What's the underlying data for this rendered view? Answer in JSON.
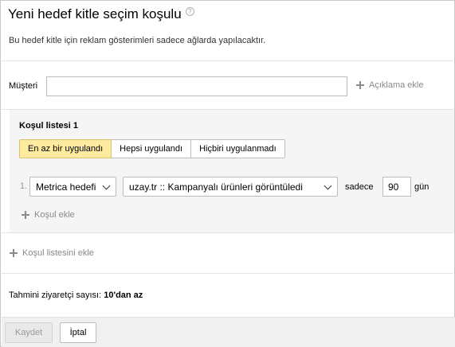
{
  "dialog": {
    "title": "Yeni hedef kitle seçim koşulu",
    "help_icon": "question-circle-icon",
    "subtitle": "Bu hedef kitle için reklam gösterimleri sadece ağlarda yapılacaktır."
  },
  "customer": {
    "label": "Müşteri",
    "value": "",
    "placeholder": "",
    "description_link": "Açıklama ekle"
  },
  "condition_list": {
    "title": "Koşul listesi 1",
    "modes": [
      {
        "label": "En az bir uygulandı",
        "active": true
      },
      {
        "label": "Hepsi uygulandı",
        "active": false
      },
      {
        "label": "Hiçbiri uygulanmadı",
        "active": false
      }
    ],
    "conditions": [
      {
        "index": "1.",
        "type": "Metrica hedefi",
        "goal": "uzay.tr :: Kampanyalı ürünleri görüntüledi",
        "only_label": "sadece",
        "days": "90",
        "days_label": "gün"
      }
    ],
    "add_condition": "Koşul ekle"
  },
  "add_condition_list": "Koşul listesini ekle",
  "estimate": {
    "label": "Tahmini ziyaretçi sayısı:",
    "value": "10'dan az"
  },
  "footer": {
    "save": "Kaydet",
    "cancel": "İptal"
  },
  "colors": {
    "active_segment": "#ffeba0",
    "panel_bg": "#f5f5f5",
    "footer_bg": "#f0f0f0",
    "link_gray": "#888888"
  }
}
